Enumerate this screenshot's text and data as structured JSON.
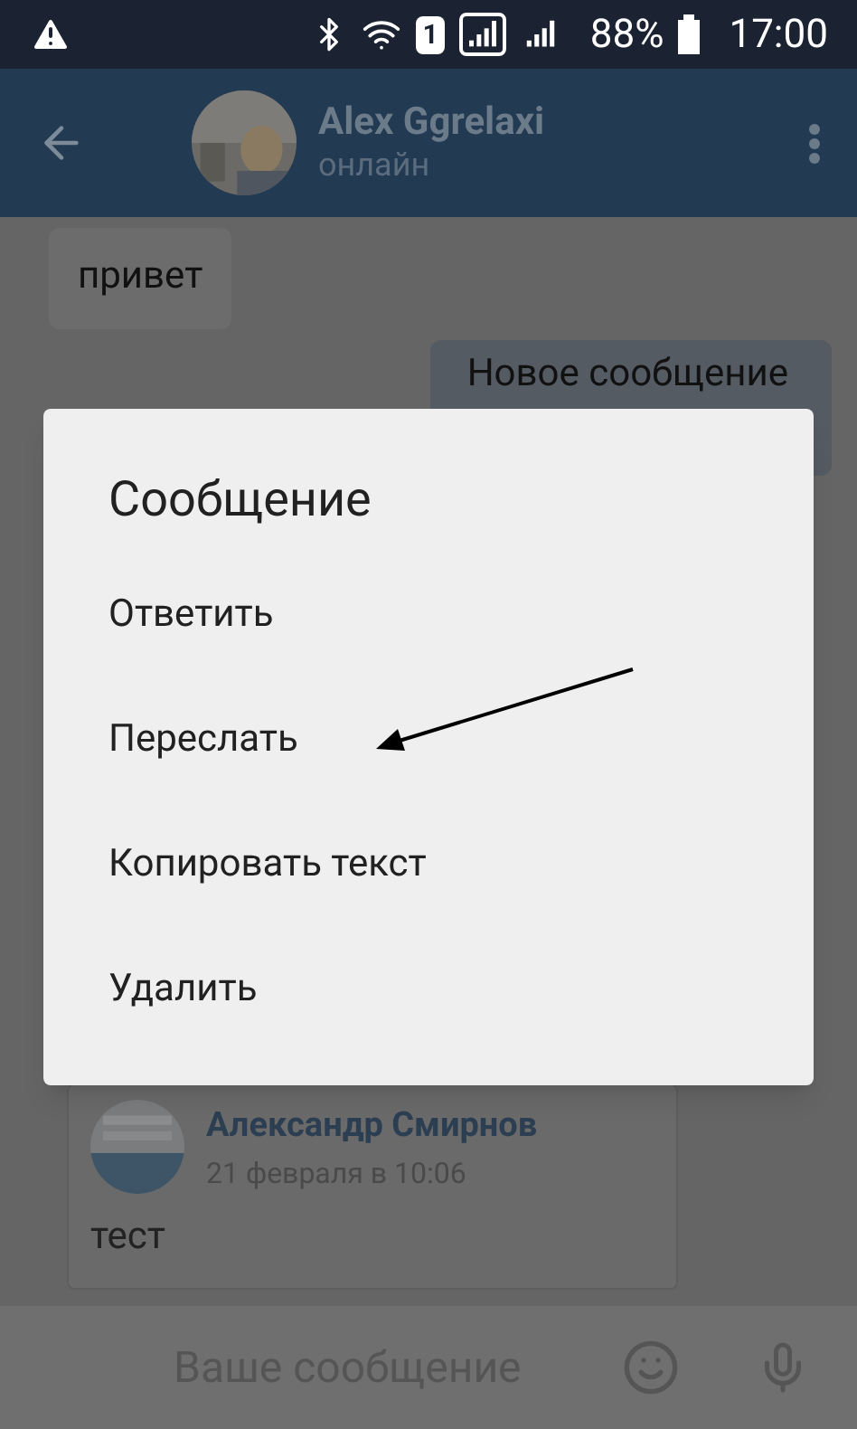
{
  "status_bar": {
    "sim_slot": "1",
    "battery": "88%",
    "time": "17:00"
  },
  "header": {
    "name": "Alex Ggrelaxi",
    "status": "онлайн"
  },
  "messages": [
    {
      "kind": "incoming",
      "text": "привет"
    },
    {
      "kind": "outgoing",
      "text": "Новое сообщение"
    },
    {
      "kind": "forwarded",
      "author": "Александр Смирнов",
      "date": "21 февраля в 10:06",
      "text": "тест"
    }
  ],
  "dialog": {
    "title": "Сообщение",
    "items": [
      "Ответить",
      "Переслать",
      "Копировать текст",
      "Удалить"
    ]
  },
  "composer": {
    "placeholder": "Ваше сообщение"
  }
}
